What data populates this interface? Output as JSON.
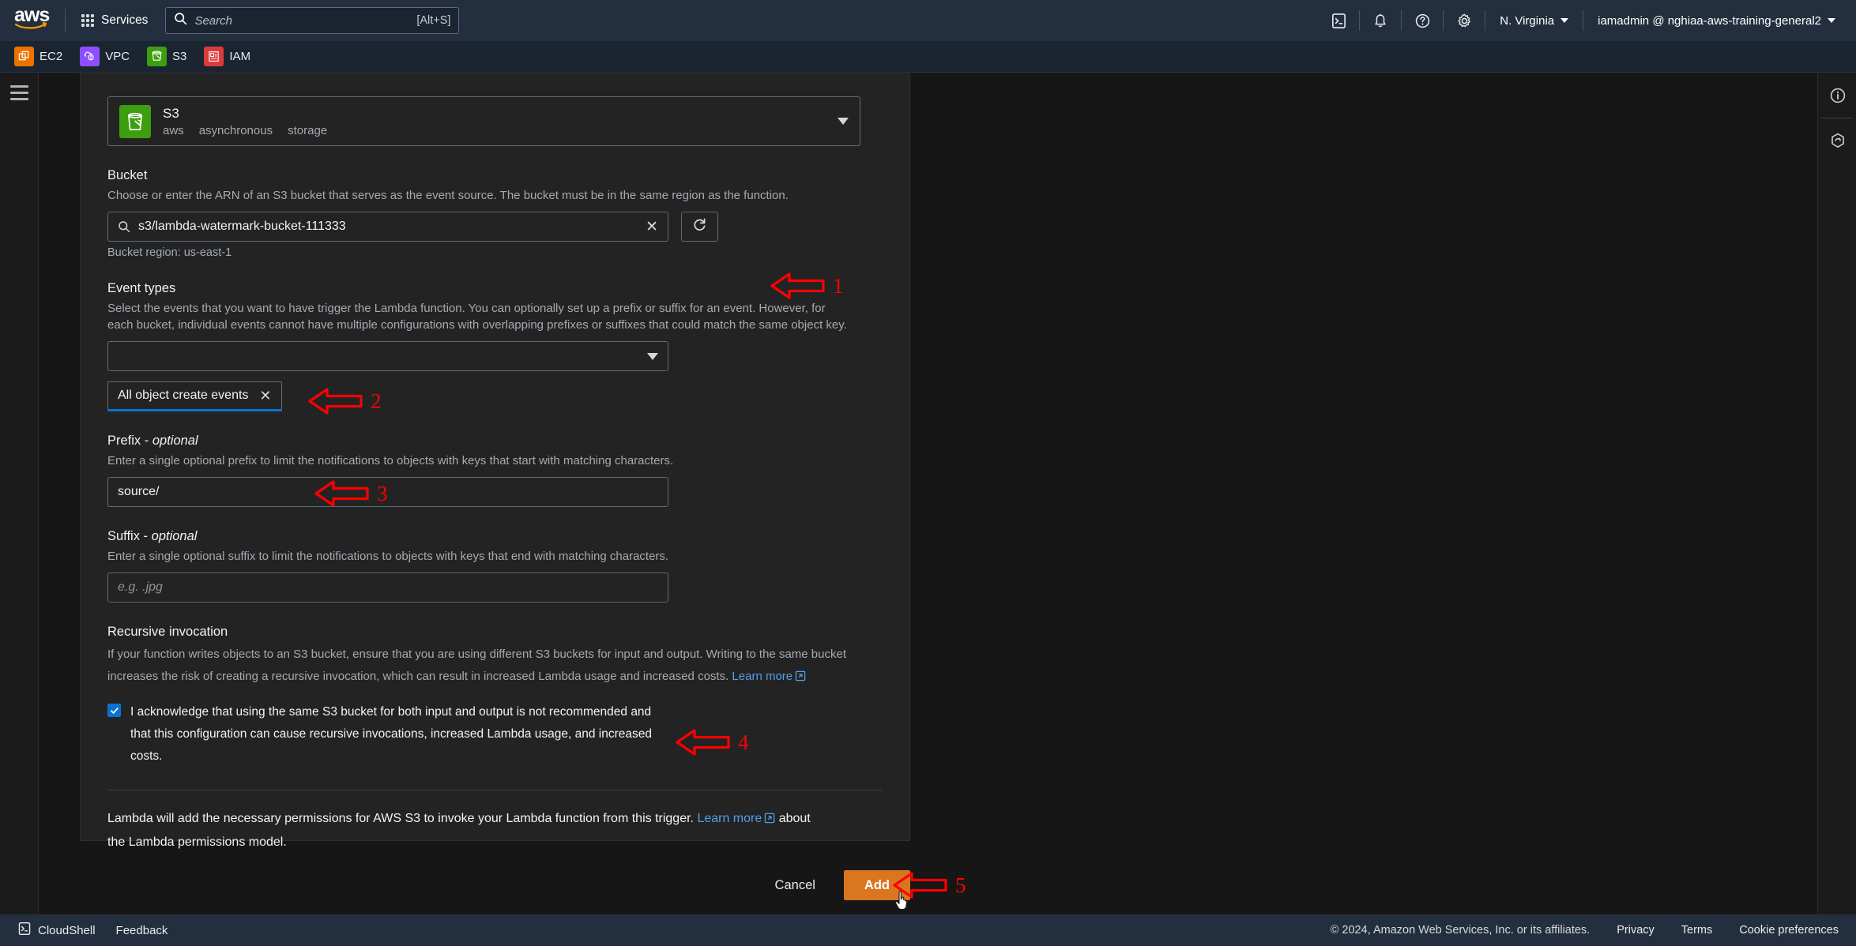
{
  "topnav": {
    "logo_text": "aws",
    "services_label": "Services",
    "services_icon": "grid-apps-icon",
    "search": {
      "placeholder": "Search",
      "shortcut": "[Alt+S]",
      "icon": "search-icon"
    },
    "icons": [
      {
        "name": "cloudshell-icon",
        "label": "CloudShell"
      },
      {
        "name": "notifications-bell-icon",
        "label": "Notifications"
      },
      {
        "name": "help-question-icon",
        "label": "Help"
      },
      {
        "name": "settings-gear-icon",
        "label": "Settings"
      }
    ],
    "region": "N. Virginia",
    "account": "iamadmin @ nghiaa-aws-training-general2"
  },
  "favorites": [
    {
      "label": "EC2",
      "icon": "ec2-icon",
      "color": "#ed7100"
    },
    {
      "label": "VPC",
      "icon": "vpc-icon",
      "color": "#8c4fff"
    },
    {
      "label": "S3",
      "icon": "s3-bucket-icon",
      "color": "#3d9e10"
    },
    {
      "label": "IAM",
      "icon": "iam-icon",
      "color": "#dd3b3b"
    }
  ],
  "rails": {
    "menu_icon": "hamburger-menu-icon",
    "right_icons": [
      {
        "name": "info-circle-icon"
      },
      {
        "name": "cloud-shield-icon"
      }
    ]
  },
  "trigger_form": {
    "source": {
      "title": "S3",
      "icon": "s3-bucket-icon",
      "tags": [
        "aws",
        "asynchronous",
        "storage"
      ]
    },
    "bucket": {
      "label": "Bucket",
      "description": "Choose or enter the ARN of an S3 bucket that serves as the event source. The bucket must be in the same region as the function.",
      "value": "s3/lambda-watermark-bucket-111333",
      "search_icon": "search-icon",
      "clear_icon": "clear-x-icon",
      "refresh_icon": "refresh-icon",
      "region_hint": "Bucket region: us-east-1"
    },
    "event_types": {
      "label": "Event types",
      "description": "Select the events that you want to have trigger the Lambda function. You can optionally set up a prefix or suffix for an event. However, for each bucket, individual events cannot have multiple configurations with overlapping prefixes or suffixes that could match the same object key.",
      "select_value": "",
      "selected_tokens": [
        {
          "label": "All object create events",
          "remove_icon": "remove-x-icon"
        }
      ],
      "accent_color": "#0972d3"
    },
    "prefix": {
      "label": "Prefix - ",
      "label_em": "optional",
      "description": "Enter a single optional prefix to limit the notifications to objects with keys that start with matching characters.",
      "value": "source/"
    },
    "suffix": {
      "label": "Suffix - ",
      "label_em": "optional",
      "description": "Enter a single optional suffix to limit the notifications to objects with keys that end with matching characters.",
      "value": "",
      "placeholder": "e.g. .jpg"
    },
    "recursive": {
      "label": "Recursive invocation",
      "description_1": "If your function writes objects to an S3 bucket, ensure that you are using different S3 buckets for input and output. Writing to the same bucket increases the risk of creating a recursive invocation, which can result in increased Lambda usage and increased costs. ",
      "learn_more": "Learn more",
      "acknowledgement": "I acknowledge that using the same S3 bucket for both input and output is not recommended and that this configuration can cause recursive invocations, increased Lambda usage, and increased costs.",
      "checked": true
    },
    "permissions_note": {
      "text_1": "Lambda will add the necessary permissions for AWS S3 to invoke your Lambda function from this trigger. ",
      "learn_more": "Learn more",
      "text_2": " about the Lambda permissions model."
    },
    "actions": {
      "cancel_label": "Cancel",
      "add_label": "Add",
      "add_color": "#d9761f"
    }
  },
  "annotations": {
    "color": "#ff0000",
    "items": [
      {
        "number": "1",
        "target": "bucket-input"
      },
      {
        "number": "2",
        "target": "event-type-token"
      },
      {
        "number": "3",
        "target": "prefix-input"
      },
      {
        "number": "4",
        "target": "recursive-acknowledgement-checkbox"
      },
      {
        "number": "5",
        "target": "add-button"
      }
    ]
  },
  "bottombar": {
    "cloudshell": "CloudShell",
    "feedback": "Feedback",
    "copyright": "© 2024, Amazon Web Services, Inc. or its affiliates.",
    "links": [
      "Privacy",
      "Terms",
      "Cookie preferences"
    ]
  }
}
